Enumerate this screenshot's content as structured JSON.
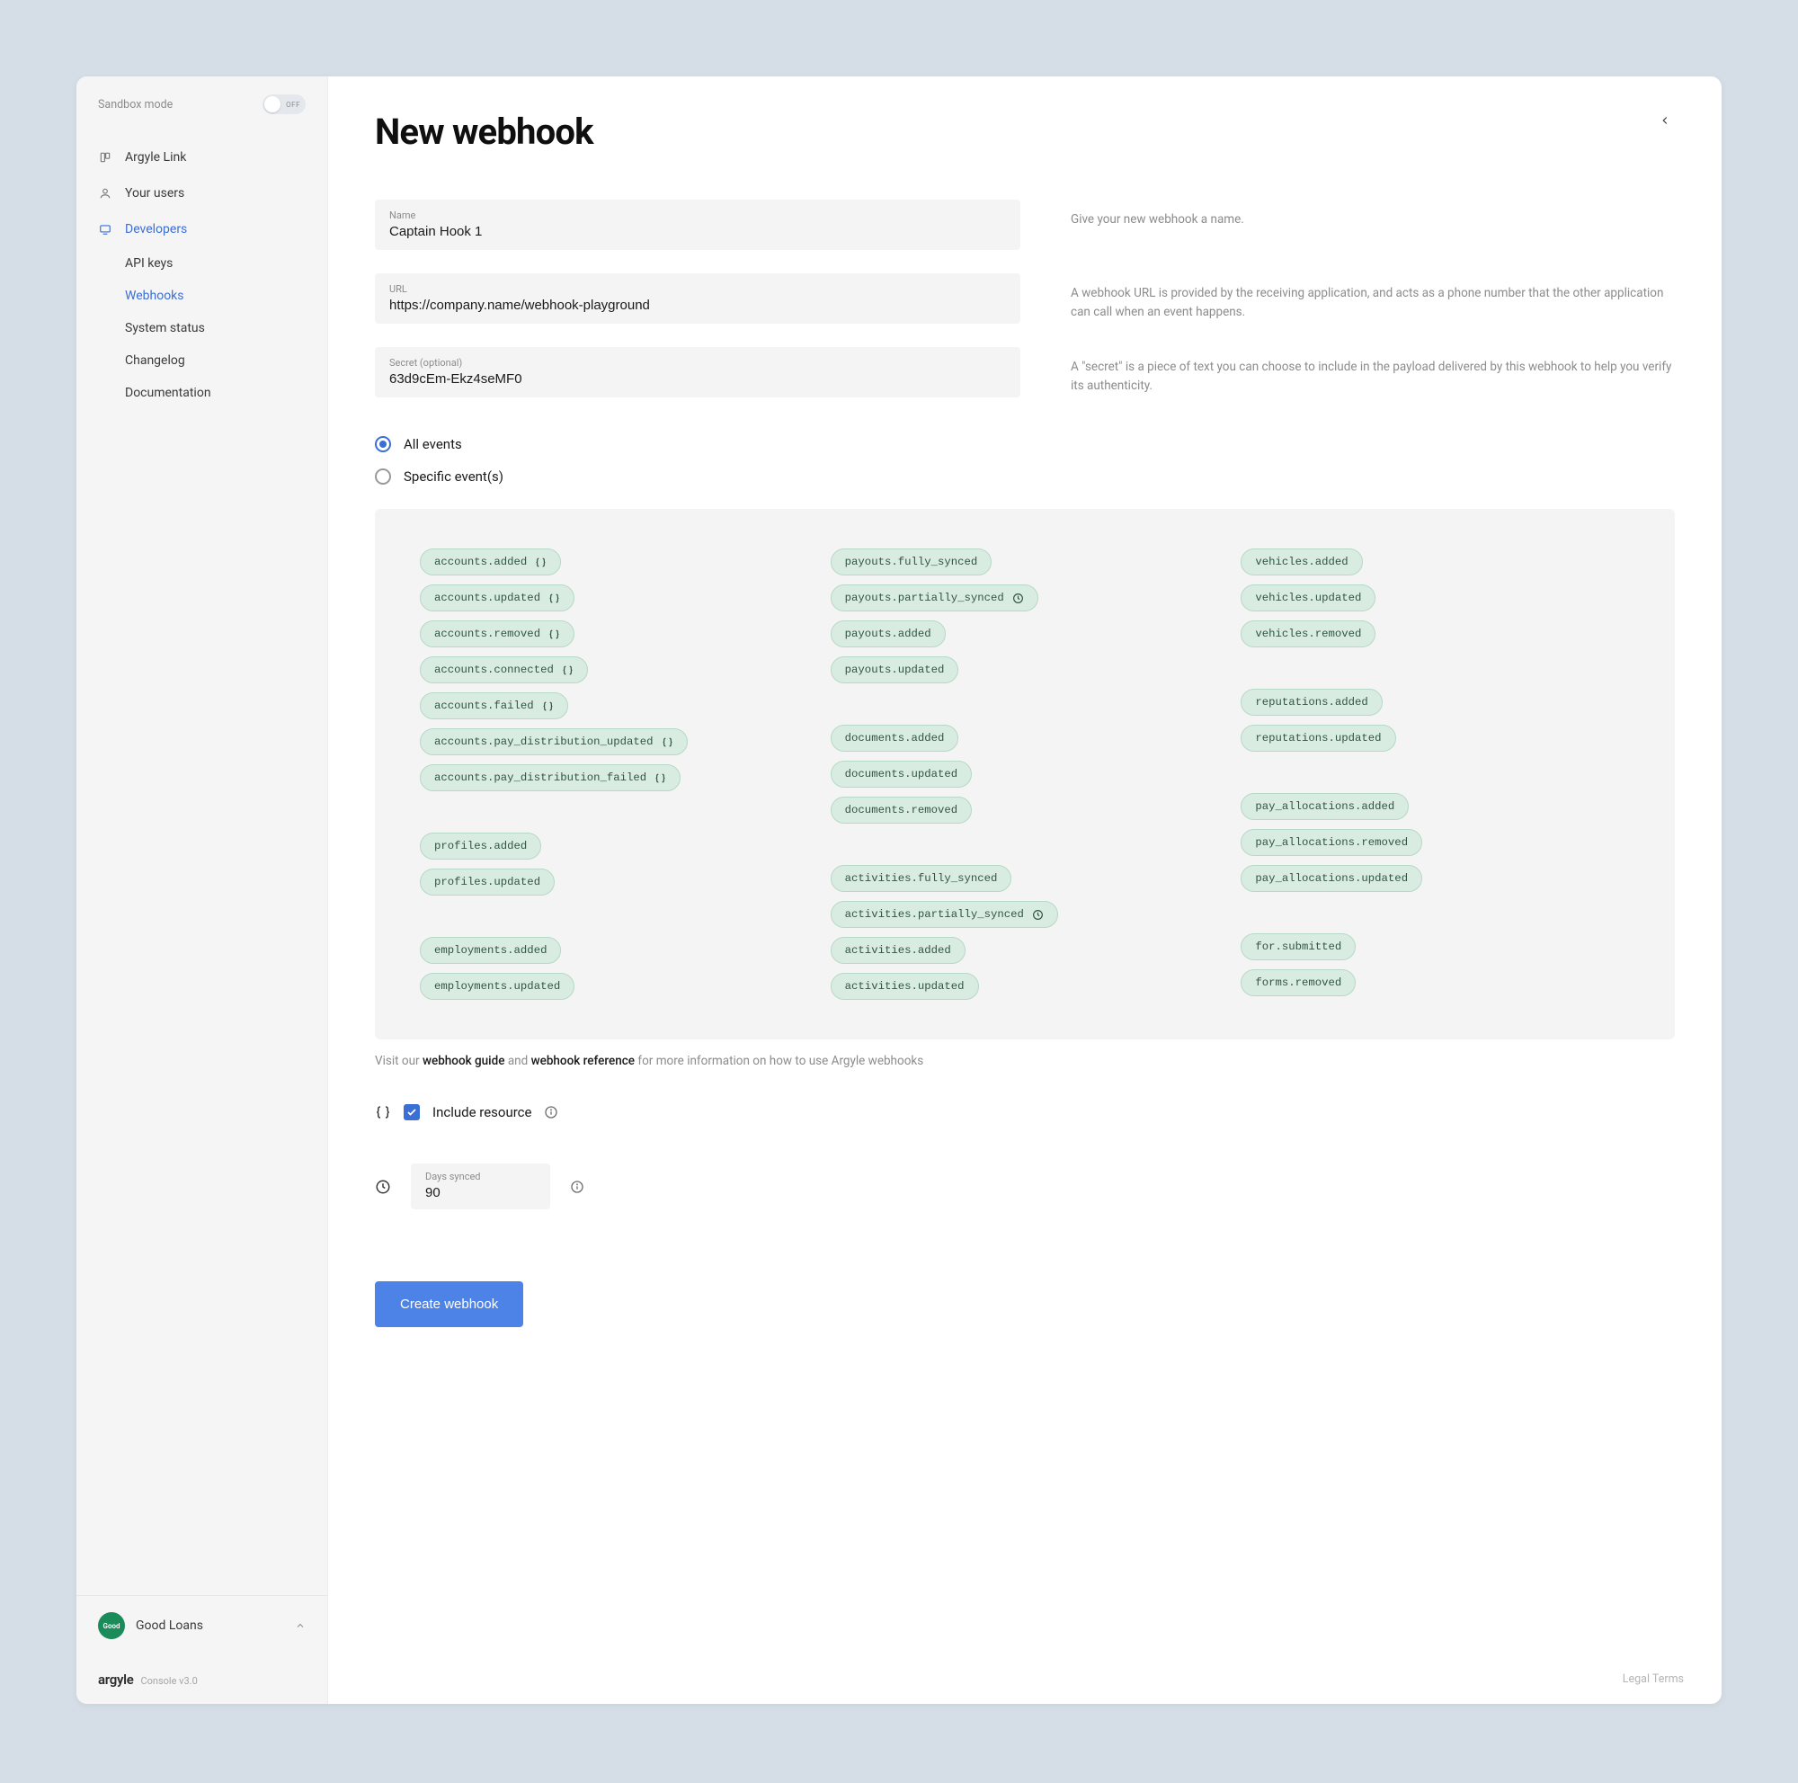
{
  "sidebar": {
    "sandbox_label": "Sandbox mode",
    "toggle_off": "OFF",
    "nav": [
      {
        "label": "Argyle Link",
        "active": false
      },
      {
        "label": "Your users",
        "active": false
      },
      {
        "label": "Developers",
        "active": true
      }
    ],
    "sub_nav": [
      {
        "label": "API keys"
      },
      {
        "label": "Webhooks"
      },
      {
        "label": "System status"
      },
      {
        "label": "Changelog"
      },
      {
        "label": "Documentation"
      }
    ],
    "account": {
      "initials": "Good",
      "name": "Good Loans"
    },
    "brand": "argyle",
    "version": "Console v3.0"
  },
  "page": {
    "title": "New webhook"
  },
  "fields": {
    "name": {
      "label": "Name",
      "value": "Captain Hook 1",
      "help": "Give your new webhook a name."
    },
    "url": {
      "label": "URL",
      "value": "https://company.name/webhook-playground",
      "help": "A webhook URL is provided by the receiving application, and acts as a phone number that the other application can call when an event happens."
    },
    "secret": {
      "label": "Secret (optional)",
      "value": "63d9cEm-Ekz4seMF0",
      "help": "A \"secret\" is a piece of text you can choose to include in the payload delivered by this webhook to help you verify its authenticity."
    }
  },
  "radio": {
    "all": "All events",
    "specific": "Specific event(s)"
  },
  "events": {
    "col1": [
      [
        {
          "label": "accounts.added",
          "icon": "braces"
        },
        {
          "label": "accounts.updated",
          "icon": "braces"
        },
        {
          "label": "accounts.removed",
          "icon": "braces"
        },
        {
          "label": "accounts.connected",
          "icon": "braces"
        },
        {
          "label": "accounts.failed",
          "icon": "braces"
        },
        {
          "label": "accounts.pay_distribution_updated",
          "icon": "braces"
        },
        {
          "label": "accounts.pay_distribution_failed",
          "icon": "braces"
        }
      ],
      [
        {
          "label": "profiles.added"
        },
        {
          "label": "profiles.updated"
        }
      ],
      [
        {
          "label": "employments.added"
        },
        {
          "label": "employments.updated"
        }
      ]
    ],
    "col2": [
      [
        {
          "label": "payouts.fully_synced"
        },
        {
          "label": "payouts.partially_synced",
          "icon": "clock"
        },
        {
          "label": "payouts.added"
        },
        {
          "label": "payouts.updated"
        }
      ],
      [
        {
          "label": "documents.added"
        },
        {
          "label": "documents.updated"
        },
        {
          "label": "documents.removed"
        }
      ],
      [
        {
          "label": "activities.fully_synced"
        },
        {
          "label": "activities.partially_synced",
          "icon": "clock"
        },
        {
          "label": "activities.added"
        },
        {
          "label": "activities.updated"
        }
      ]
    ],
    "col3": [
      [
        {
          "label": "vehicles.added"
        },
        {
          "label": "vehicles.updated"
        },
        {
          "label": "vehicles.removed"
        }
      ],
      [
        {
          "label": "reputations.added"
        },
        {
          "label": "reputations.updated"
        }
      ],
      [
        {
          "label": "pay_allocations.added"
        },
        {
          "label": "pay_allocations.removed"
        },
        {
          "label": "pay_allocations.updated"
        }
      ],
      [
        {
          "label": "for.submitted"
        },
        {
          "label": "forms.removed"
        }
      ]
    ]
  },
  "help_line": {
    "prefix": "Visit our ",
    "link1": "webhook guide",
    "mid": " and ",
    "link2": "webhook reference",
    "suffix": " for more information on how to use Argyle webhooks"
  },
  "include": {
    "label": "Include resource"
  },
  "days": {
    "label": "Days synced",
    "value": "90"
  },
  "create_btn": "Create webhook",
  "legal": "Legal Terms"
}
